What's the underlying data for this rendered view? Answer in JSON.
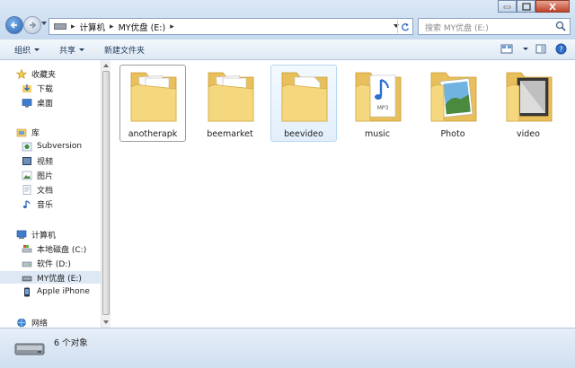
{
  "address": {
    "crumbs": [
      "计算机",
      "MY优盘 (E:)"
    ]
  },
  "search": {
    "placeholder": "搜索 MY优盘 (E:)"
  },
  "toolbar": {
    "organize": "组织",
    "share": "共享",
    "new_folder": "新建文件夹"
  },
  "sidebar": {
    "favorites": {
      "label": "收藏夹",
      "items": [
        "下载",
        "桌面"
      ]
    },
    "libraries": {
      "label": "库",
      "items": [
        "Subversion",
        "视频",
        "图片",
        "文档",
        "音乐"
      ]
    },
    "computer": {
      "label": "计算机",
      "items": [
        "本地磁盘 (C:)",
        "软件 (D:)",
        "MY优盘 (E:)",
        "Apple iPhone"
      ],
      "selected": "MY优盘 (E:)"
    },
    "network": {
      "label": "网络"
    }
  },
  "folders": [
    {
      "name": "anotherapk",
      "kind": "documents",
      "state": "focused"
    },
    {
      "name": "beemarket",
      "kind": "documents",
      "state": "normal"
    },
    {
      "name": "beevideo",
      "kind": "document",
      "state": "hover"
    },
    {
      "name": "music",
      "kind": "mp3",
      "state": "normal"
    },
    {
      "name": "Photo",
      "kind": "photo",
      "state": "normal"
    },
    {
      "name": "video",
      "kind": "video",
      "state": "normal"
    }
  ],
  "status": {
    "count_text": "6 个对象"
  },
  "colors": {
    "folder_front": "#f5d77e",
    "folder_back": "#e8bf5a",
    "selection": "#dde8f4",
    "window_frame": "#c9dcef"
  }
}
